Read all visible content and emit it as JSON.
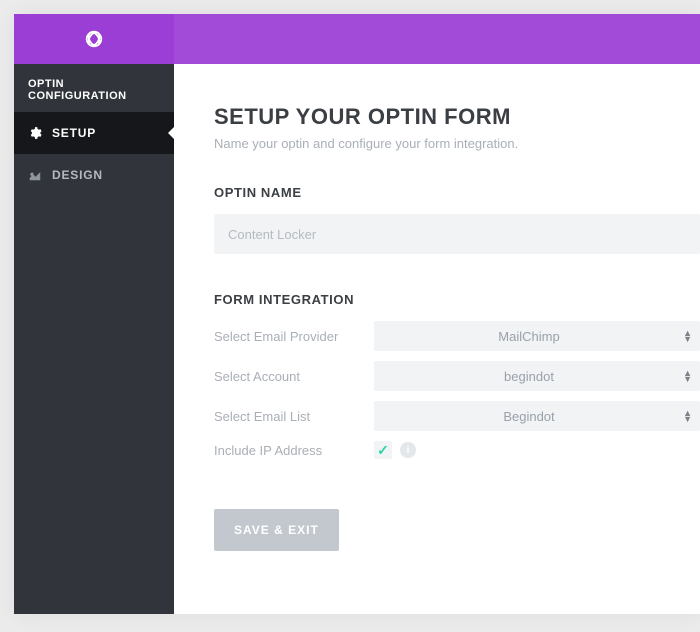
{
  "sidebar": {
    "header": "OPTIN CONFIGURATION",
    "items": [
      {
        "label": "SETUP",
        "icon": "gear-icon"
      },
      {
        "label": "DESIGN",
        "icon": "design-icon"
      }
    ]
  },
  "main": {
    "title": "SETUP YOUR OPTIN FORM",
    "subtitle": "Name your optin and configure your form integration.",
    "optin_name_heading": "OPTIN NAME",
    "optin_name_placeholder": "Content Locker",
    "form_integration_heading": "FORM INTEGRATION",
    "fields": {
      "email_provider": {
        "label": "Select Email Provider",
        "value": "MailChimp"
      },
      "account": {
        "label": "Select Account",
        "value": "begindot"
      },
      "email_list": {
        "label": "Select Email List",
        "value": "Begindot"
      },
      "include_ip": {
        "label": "Include IP Address",
        "checked": true
      }
    },
    "save_label": "SAVE & EXIT"
  }
}
